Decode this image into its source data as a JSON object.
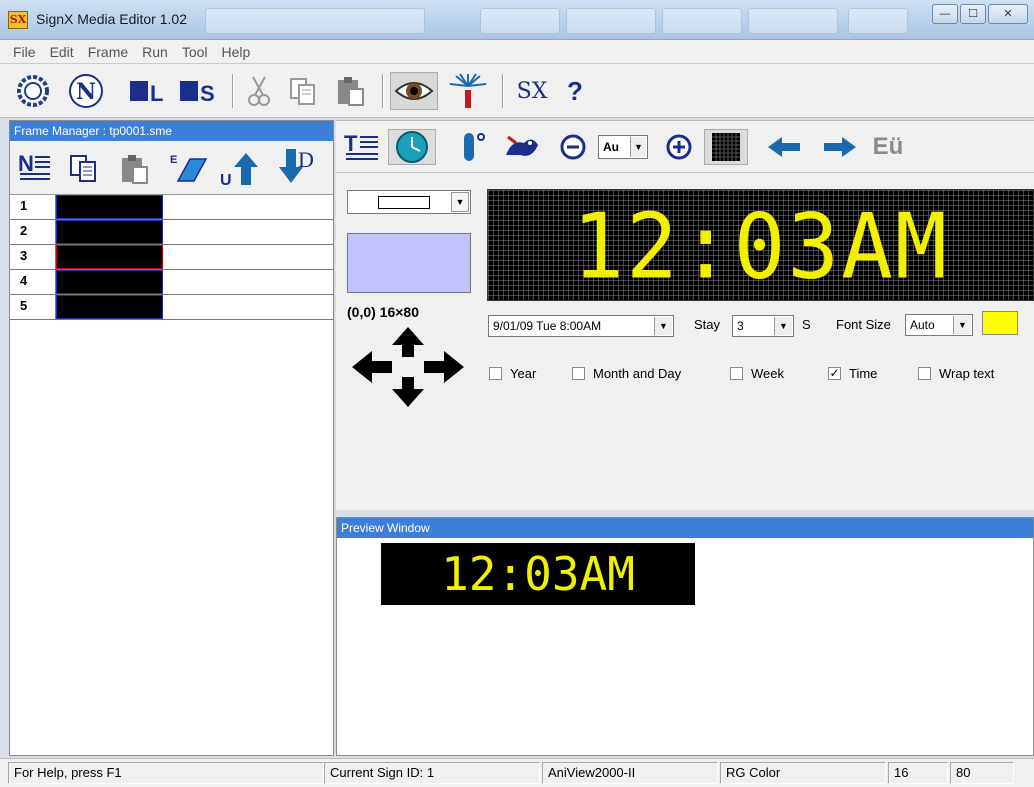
{
  "window": {
    "title": "SignX Media Editor 1.02",
    "logo": "SX",
    "controls": {
      "minimize": "—",
      "maximize": "☐",
      "close": "✕"
    }
  },
  "menu": [
    "File",
    "Edit",
    "Frame",
    "Run",
    "Tool",
    "Help"
  ],
  "toolbar": {
    "items": [
      "gear-icon",
      "new-icon",
      "L-icon",
      "S-icon",
      "cut-icon",
      "copy-icon",
      "paste-icon",
      "preview-eye-icon",
      "transmit-icon",
      "sx-icon",
      "help-icon"
    ],
    "sx_label": "SX",
    "help_label": "?"
  },
  "frame_manager": {
    "title": "Frame Manager : tp0001.sme",
    "tools": [
      "new-frame-icon",
      "copy-frame-icon",
      "paste-frame-icon",
      "erase-frame-icon",
      "move-up-icon",
      "move-down-icon"
    ],
    "rows": [
      {
        "num": "1",
        "selected": false
      },
      {
        "num": "2",
        "selected": false
      },
      {
        "num": "3",
        "selected": true
      },
      {
        "num": "4",
        "selected": false
      },
      {
        "num": "5",
        "selected": false
      }
    ]
  },
  "editor_toolbar": {
    "items": [
      "text-icon",
      "clock-icon",
      "thermometer-icon",
      "animation-icon",
      "zoom-out-icon",
      "zoom-select",
      "zoom-in-icon",
      "grid-icon",
      "arrow-left-icon",
      "arrow-right-icon",
      "font-icon"
    ],
    "zoom_value": "Au",
    "font_label": "Eü"
  },
  "editor": {
    "position_label": "(0,0) 16×80",
    "led_text": "12:03AM",
    "datetime_format": "9/01/09 Tue 8:00AM",
    "stay_label": "Stay",
    "stay_value": "3",
    "stay_unit": "S",
    "font_size_label": "Font Size",
    "font_size_value": "Auto",
    "text_color": "#ffff00",
    "options": [
      {
        "label": "Year",
        "checked": false
      },
      {
        "label": "Month and Day",
        "checked": false
      },
      {
        "label": "Week",
        "checked": false
      },
      {
        "label": "Time",
        "checked": true
      },
      {
        "label": "Wrap text",
        "checked": false
      }
    ]
  },
  "preview": {
    "title": "Preview Window",
    "text": "12:03AM"
  },
  "status": {
    "help": "For Help, press F1",
    "sign_id": "Current Sign ID: 1",
    "model": "AniView2000-II",
    "color_mode": "RG Color",
    "rows": "16",
    "cols": "80"
  }
}
